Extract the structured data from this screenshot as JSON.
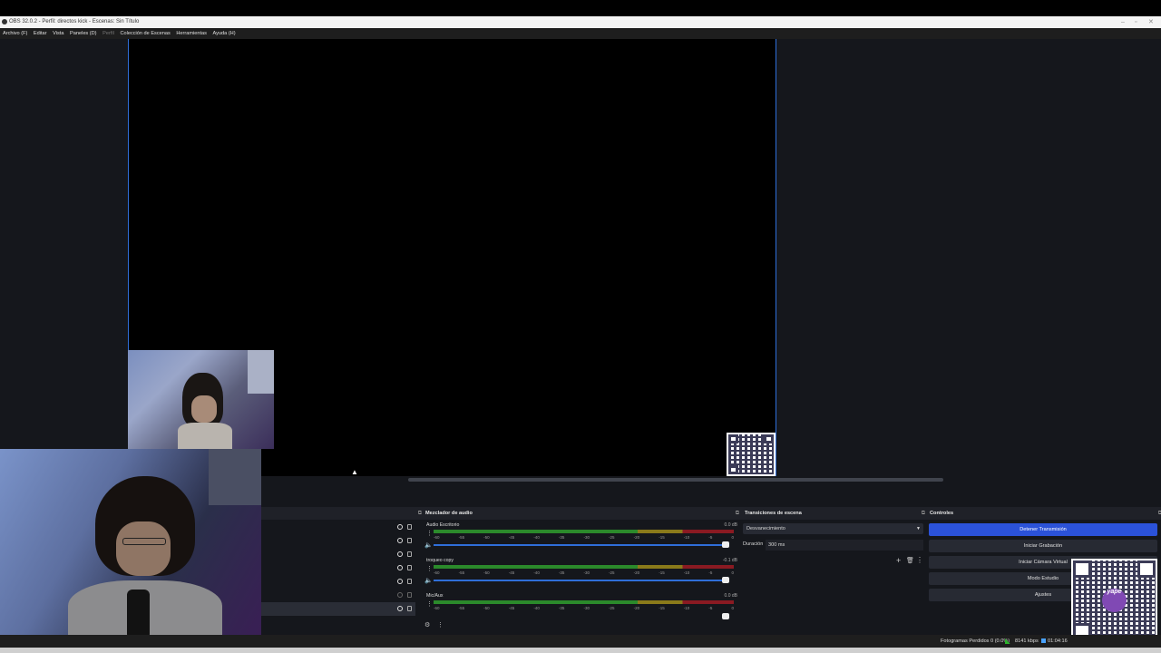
{
  "window": {
    "title": "OBS 32.0.2 - Perfil: directos kick - Escenas: Sin Título",
    "controls": [
      "–",
      "▫",
      "✕"
    ]
  },
  "menu": [
    "Archivo (F)",
    "Editar",
    "Vista",
    "Paneles (D)",
    "Perfil",
    "Colección de Escenas",
    "Herramientas",
    "Ayuda (H)"
  ],
  "mixer": {
    "title": "Mezclador de audio",
    "channels": [
      {
        "name": "Audio Escritorio",
        "db": "0.0 dB"
      },
      {
        "name": "troqueo copy",
        "db": "-0.1 dB"
      },
      {
        "name": "Mic/Aux",
        "db": "0.0 dB"
      }
    ],
    "scale": [
      "-60",
      "-55",
      "-50",
      "-45",
      "-40",
      "-35",
      "-30",
      "-25",
      "-20",
      "-15",
      "-10",
      "-5",
      "0"
    ]
  },
  "transitions": {
    "title": "Transiciones de escena",
    "selected": "Desvanecimiento",
    "duration_label": "Duración",
    "duration_value": "300 ms"
  },
  "controls": {
    "title": "Controles",
    "buttons": [
      "Detener Transmisión",
      "Iniciar Grabación",
      "Iniciar Cámara Virtual",
      "Modo Estudio",
      "Ajustes"
    ]
  },
  "status": {
    "dropped": "Fotogramas Perdidos 0 (0.0%)",
    "bitrate": "8141 kbps",
    "time": "01:04:16"
  },
  "qr_logo": "yape",
  "colors": {
    "accent": "#2f6ed8",
    "primary_button": "#2b52d8",
    "meter_green": "#2b8a2b",
    "meter_yellow": "#8a7a1a",
    "meter_red": "#8a1a22"
  }
}
